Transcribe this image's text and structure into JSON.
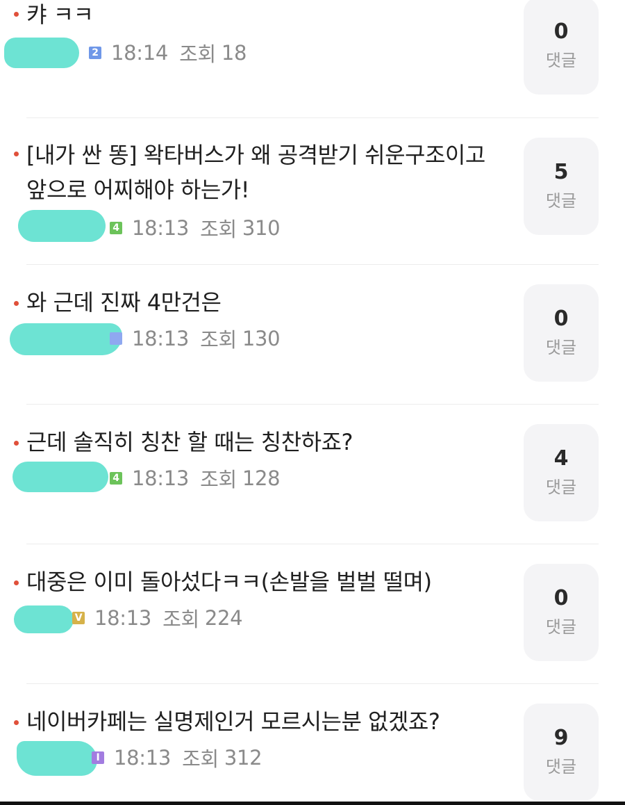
{
  "posts": [
    {
      "title": "캬 ㅋㅋ",
      "level": "2",
      "level_color": "#6f97e8",
      "time": "18:14",
      "views_label": "조회",
      "views": "18",
      "comments": "0",
      "comments_label": "댓글"
    },
    {
      "title": "[내가 싼 똥] 왁타버스가 왜 공격받기 쉬운구조이고 앞으로 어찌해야 하는가!",
      "level": "4",
      "level_color": "#6cc35a",
      "time": "18:13",
      "views_label": "조회",
      "views": "310",
      "comments": "5",
      "comments_label": "댓글"
    },
    {
      "title": "와 근데 진짜 4만건은",
      "level": "",
      "level_color": "#8fa8f0",
      "time": "18:13",
      "views_label": "조회",
      "views": "130",
      "comments": "0",
      "comments_label": "댓글"
    },
    {
      "title": "근데 솔직히 칭찬 할 때는 칭찬하죠?",
      "level": "4",
      "level_color": "#6cc35a",
      "time": "18:13",
      "views_label": "조회",
      "views": "128",
      "comments": "4",
      "comments_label": "댓글"
    },
    {
      "title": "대중은 이미 돌아섰다ㅋㅋ(손발을 벌벌 떨며)",
      "level": "V",
      "level_color": "#d6b24a",
      "time": "18:13",
      "views_label": "조회",
      "views": "224",
      "comments": "0",
      "comments_label": "댓글"
    },
    {
      "title": "네이버카페는 실명제인거 모르시는분 없겠죠?",
      "level": "I",
      "level_color": "#a27ce0",
      "time": "18:13",
      "views_label": "조회",
      "views": "312",
      "comments": "9",
      "comments_label": "댓글"
    }
  ]
}
